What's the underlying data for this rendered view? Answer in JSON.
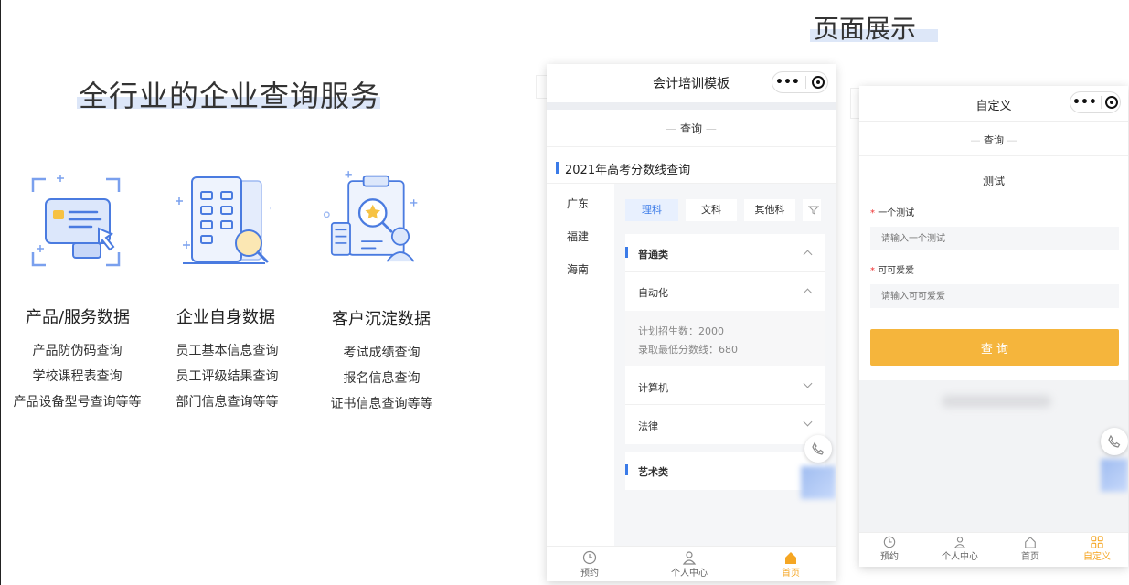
{
  "hero": {
    "title": "全行业的企业查询服务"
  },
  "categories": [
    {
      "title": "产品/服务数据",
      "items": [
        "产品防伪码查询",
        "学校课程表查询",
        "产品设备型号查询等等"
      ],
      "icon": "id-card-illustration"
    },
    {
      "title": "企业自身数据",
      "items": [
        "员工基本信息查询",
        "员工评级结果查询",
        "部门信息查询等等"
      ],
      "icon": "building-search-illustration"
    },
    {
      "title": "客户沉淀数据",
      "items": [
        "考试成绩查询",
        "报名信息查询",
        "证书信息查询等等"
      ],
      "icon": "clipboard-search-illustration"
    }
  ],
  "showcase": {
    "title": "页面展示"
  },
  "phone1": {
    "nav_title": "会计培训模板",
    "section_header": "查询",
    "query_title": "2021年高考分数线查询",
    "regions": [
      "广东",
      "福建",
      "海南"
    ],
    "subject_tabs": [
      "理科",
      "文科",
      "其他科"
    ],
    "group1": "普通类",
    "major_open": "自动化",
    "detail_line1": "计划招生数：2000",
    "detail_line2": "录取最低分数线：680",
    "major2": "计算机",
    "major3": "法律",
    "group2": "艺术类",
    "tabbar": [
      "预约",
      "个人中心",
      "首页"
    ],
    "accent": "#f5a623"
  },
  "phone2": {
    "nav_title": "自定义",
    "section_header": "查询",
    "form_title": "测试",
    "field1_label": "一个测试",
    "field1_placeholder": "请输入一个测试",
    "field2_label": "可可爱爱",
    "field2_placeholder": "请输入可可爱爱",
    "submit_label": "查 询",
    "submit_color": "#f5b53c",
    "tabbar": [
      "预约",
      "个人中心",
      "首页",
      "自定义"
    ]
  }
}
